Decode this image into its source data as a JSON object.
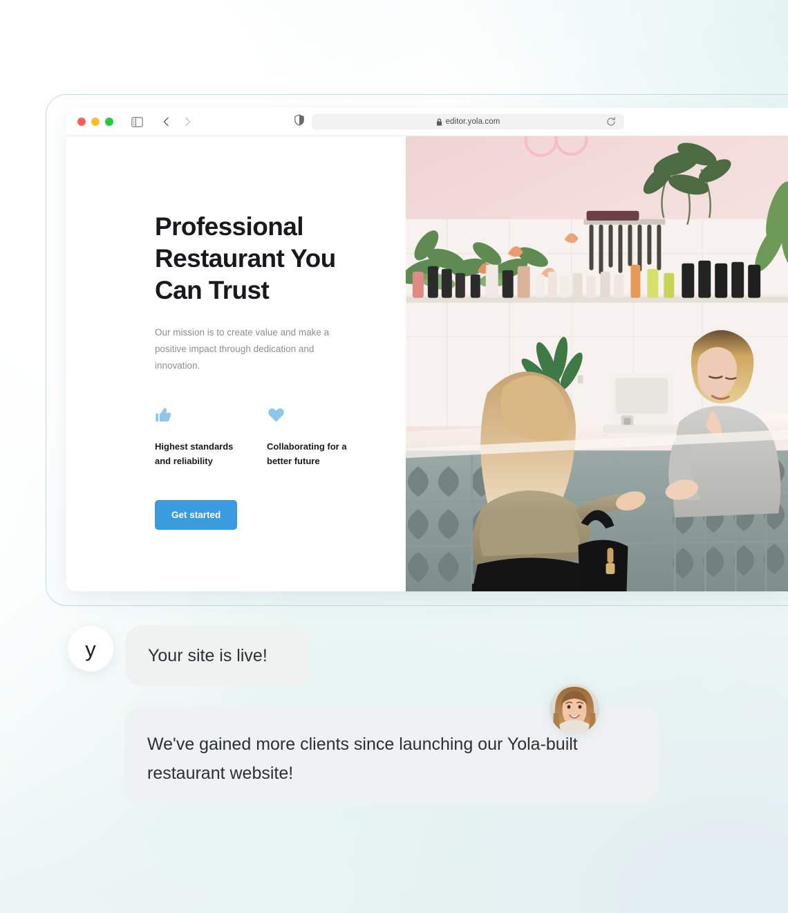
{
  "browser": {
    "traffic_lights": [
      "close-red",
      "minimize-amber",
      "maximize-green"
    ],
    "sidebar_icon": "sidebar-toggle-icon",
    "back_icon": "chevron-left-icon",
    "forward_icon": "chevron-right-icon",
    "shield_icon": "shield-privacy-icon",
    "lock_icon": "lock-icon",
    "url": "editor.yola.com",
    "reload_icon": "reload-icon"
  },
  "site": {
    "hero_title": "Professional Restaurant You Can Trust",
    "hero_subtitle": "Our mission is to create value and make a positive impact through dedication and innovation.",
    "features": [
      {
        "icon": "thumbs-up-icon",
        "label": "Highest standards and reliability"
      },
      {
        "icon": "heart-icon",
        "label": "Collaborating for a better future"
      }
    ],
    "cta_label": "Get started",
    "photo_alt": "two-women-at-salon-counter-photo"
  },
  "chat": {
    "brand_avatar_letter": "y",
    "message_1": "Your site is live!",
    "message_2": "We've gained more clients since launching our Yola-built restaurant website!",
    "client_avatar": "smiling-woman-avatar-photo"
  },
  "colors": {
    "accent_blue": "#3b9bdf",
    "feature_icon_blue": "#8cc6ea",
    "bubble_grey": "#f0f2f2",
    "heading_dark": "#17191c",
    "body_grey": "#8b8f94",
    "frame_border": "#bcdbe8"
  }
}
